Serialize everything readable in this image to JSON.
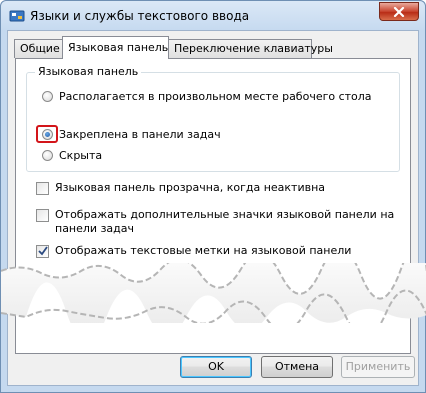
{
  "window": {
    "title": "Языки и службы текстового ввода",
    "close_icon": "close-x-icon",
    "title_icon": "language-settings-icon"
  },
  "tabs": [
    {
      "label": "Общие",
      "active": false
    },
    {
      "label": "Языковая панель",
      "active": true
    },
    {
      "label": "Переключение клавиатуры",
      "active": false
    }
  ],
  "language_bar_group": {
    "legend": "Языковая панель",
    "options": [
      {
        "label": "Располагается в произвольном месте рабочего стола",
        "selected": false
      },
      {
        "label": "Закреплена в панели задач",
        "selected": true
      },
      {
        "label": "Скрыта",
        "selected": false
      }
    ]
  },
  "checkboxes": [
    {
      "label": "Языковая панель прозрачна, когда неактивна",
      "checked": false
    },
    {
      "label_line1": "Отображать дополнительные значки языковой панели на",
      "label_line2": "панели задач",
      "checked": false
    },
    {
      "label": "Отображать текстовые метки на языковой панели",
      "checked": true
    }
  ],
  "buttons": {
    "ok": "OK",
    "cancel": "Отмена",
    "apply": "Применить"
  },
  "colors": {
    "highlight_frame": "#d3151a",
    "titlebar": "#c6daf0",
    "radio_selected": "#1d5aa5"
  }
}
